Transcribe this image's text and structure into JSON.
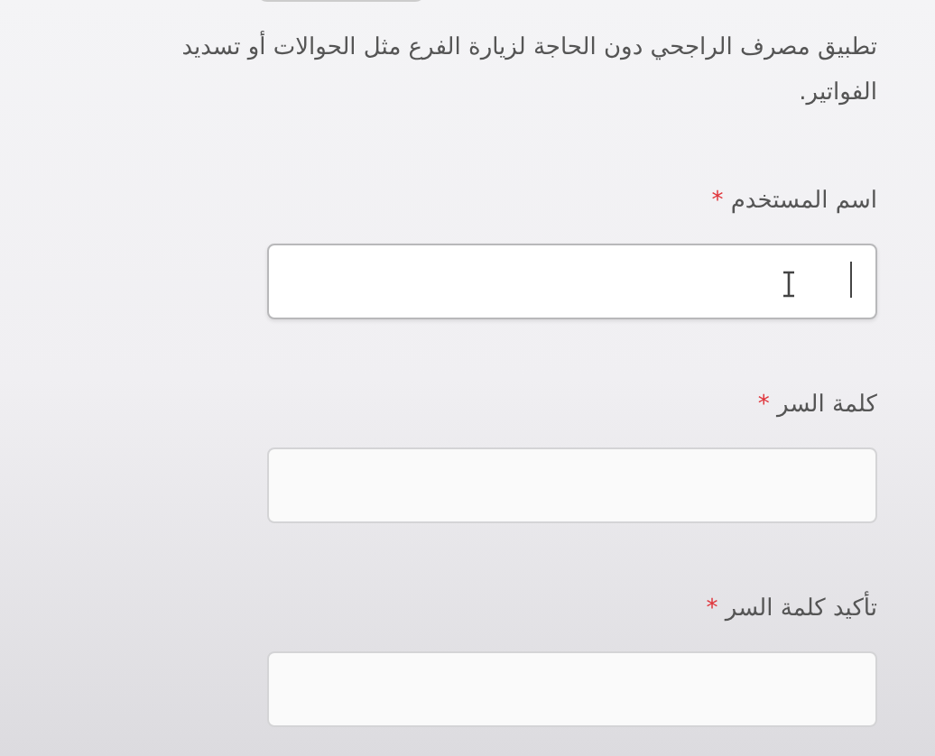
{
  "description": "تطبيق مصرف الراجحي دون الحاجة لزيارة الفرع مثل الحوالات أو تسديد الفواتير.",
  "fields": [
    {
      "label": "اسم المستخدم",
      "required_mark": "*",
      "focused": true
    },
    {
      "label": "كلمة السر",
      "required_mark": "*",
      "focused": false
    },
    {
      "label": "تأكيد كلمة السر",
      "required_mark": "*",
      "focused": false
    }
  ]
}
